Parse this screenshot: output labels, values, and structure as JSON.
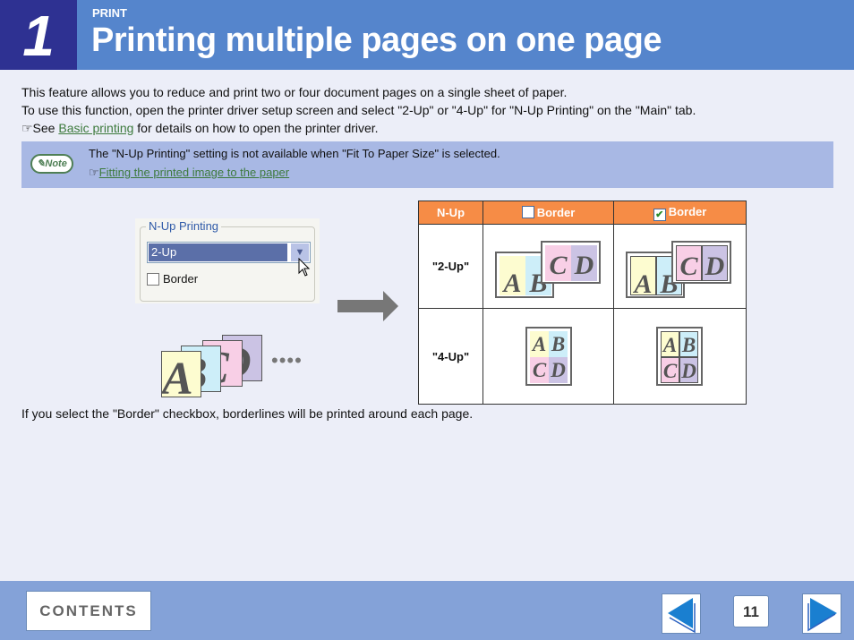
{
  "header": {
    "chapter": "1",
    "section": "PRINT",
    "title": "Printing multiple pages on one page"
  },
  "intro": {
    "line1": "This feature allows you to reduce and print two or four document pages on a single sheet of paper.",
    "line2": "To use this function, open the printer driver setup screen and select \"2-Up\" or \"4-Up\" for \"N-Up Printing\" on the \"Main\" tab.",
    "see_prefix": "☞See ",
    "see_link": "Basic printing",
    "see_suffix": " for details on how to open the printer driver."
  },
  "note": {
    "badge": "✎Note",
    "text": "The \"N-Up Printing\" setting is not available when \"Fit To Paper Size\" is selected.",
    "ref_icon": "☞",
    "link": "Fitting the printed image to the paper"
  },
  "dialog": {
    "group_label": "N-Up Printing",
    "selected": "2-Up",
    "checkbox_label": "Border",
    "checkbox_checked": false
  },
  "illustration": {
    "pages": [
      "A",
      "B",
      "C",
      "D"
    ],
    "ellipsis": "••••"
  },
  "table": {
    "headers": [
      "N-Up",
      "Border",
      "Border"
    ],
    "header_checks": [
      false,
      true
    ],
    "rows": [
      {
        "label": "\"2-Up\""
      },
      {
        "label": "\"4-Up\""
      }
    ]
  },
  "outro": "If you select the \"Border\" checkbox, borderlines will be printed around each page.",
  "colors": {
    "A": "#fdfcd0",
    "B": "#cdeef9",
    "C": "#f8cfe6",
    "D": "#cbc3e4",
    "header_orange": "#f68c46"
  },
  "footer": {
    "contents": "CONTENTS",
    "page": "11",
    "prev_icon": "triangle-left-icon",
    "next_icon": "triangle-right-icon"
  }
}
